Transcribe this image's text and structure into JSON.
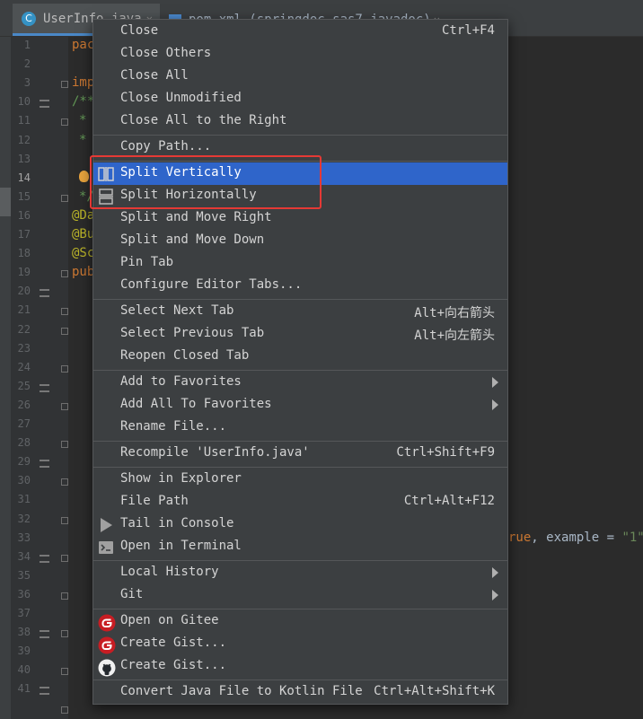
{
  "tabs": [
    {
      "label": "UserInfo.java",
      "icon": "java-class-icon",
      "icon_letter": "C"
    },
    {
      "label": "pom.xml (springdoc-sas7-javadoc)",
      "icon": "maven-icon"
    }
  ],
  "editor": {
    "line_numbers": [
      "1",
      "2",
      "3",
      "10",
      "11",
      "12",
      "13",
      "14",
      "15",
      "16",
      "17",
      "18",
      "19",
      "20",
      "21",
      "22",
      "23",
      "24",
      "25",
      "26",
      "27",
      "28",
      "29",
      "30",
      "31",
      "32",
      "33",
      "34",
      "35",
      "36",
      "37",
      "38",
      "39",
      "40",
      "41"
    ],
    "current_line": "14",
    "code_fragments": [
      "pac",
      "imp",
      "/**",
      "*",
      "*",
      "*",
      "*/",
      "@Da",
      "@Bu",
      "@Sc",
      "pub",
      "/**"
    ],
    "code_right": {
      "kw": "rue",
      "rest": ", example = ",
      "str": "\"1\")"
    }
  },
  "menu": {
    "groups": [
      [
        {
          "label": "Close",
          "shortcut": "Ctrl+F4"
        },
        {
          "label": "Close Others"
        },
        {
          "label": "Close All"
        },
        {
          "label": "Close Unmodified"
        },
        {
          "label": "Close All to the Right"
        }
      ],
      [
        {
          "label": "Copy Path..."
        }
      ],
      [
        {
          "label": "Split Vertically",
          "icon": "split-vertically-icon",
          "selected": true
        },
        {
          "label": "Split Horizontally",
          "icon": "split-horizontally-icon"
        },
        {
          "label": "Split and Move Right"
        },
        {
          "label": "Split and Move Down"
        },
        {
          "label": "Pin Tab"
        },
        {
          "label": "Configure Editor Tabs..."
        }
      ],
      [
        {
          "label": "Select Next Tab",
          "shortcut": "Alt+向右箭头"
        },
        {
          "label": "Select Previous Tab",
          "shortcut": "Alt+向左箭头"
        },
        {
          "label": "Reopen Closed Tab"
        }
      ],
      [
        {
          "label": "Add to Favorites",
          "submenu": true
        },
        {
          "label": "Add All To Favorites",
          "submenu": true
        },
        {
          "label": "Rename File..."
        }
      ],
      [
        {
          "label": "Recompile 'UserInfo.java'",
          "shortcut": "Ctrl+Shift+F9"
        }
      ],
      [
        {
          "label": "Show in Explorer"
        },
        {
          "label": "File Path",
          "shortcut": "Ctrl+Alt+F12"
        },
        {
          "label": "Tail in Console",
          "icon": "play-icon"
        },
        {
          "label": "Open in Terminal",
          "icon": "terminal-icon"
        }
      ],
      [
        {
          "label": "Local History",
          "submenu": true
        },
        {
          "label": "Git",
          "submenu": true
        }
      ],
      [
        {
          "label": "Open on Gitee",
          "icon": "gitee-icon"
        },
        {
          "label": "Create Gist...",
          "icon": "gitee-icon"
        },
        {
          "label": "Create Gist...",
          "icon": "github-icon"
        }
      ],
      [
        {
          "label": "Convert Java File to Kotlin File",
          "shortcut": "Ctrl+Alt+Shift+K"
        }
      ]
    ]
  },
  "colors": {
    "menu_bg": "#3c3f41",
    "selection": "#2f65ca",
    "highlight_box": "#e53935",
    "editor_bg": "#2b2b2b"
  }
}
